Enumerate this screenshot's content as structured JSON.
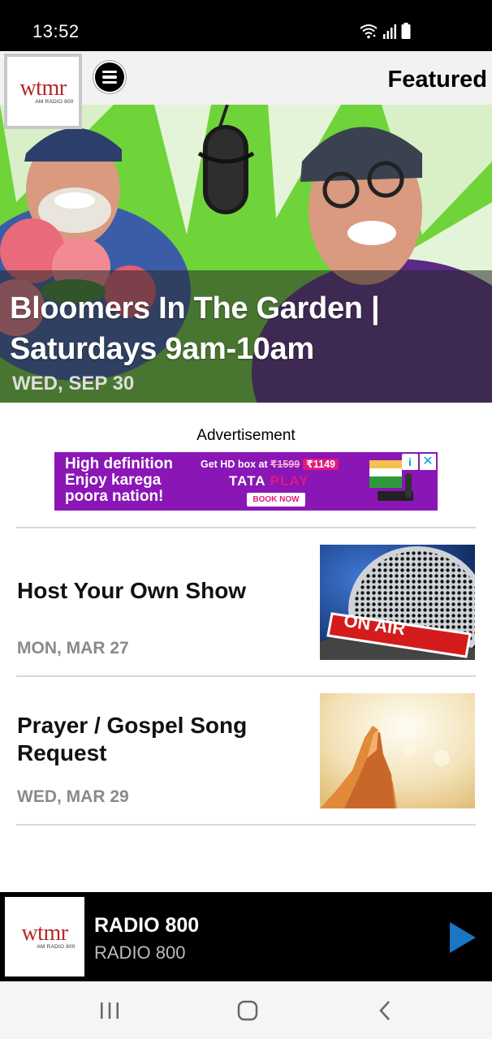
{
  "status_bar": {
    "time": "13:52",
    "icons": [
      "wifi-icon",
      "signal-icon",
      "battery-icon"
    ]
  },
  "header": {
    "logo": {
      "text": "wtmr",
      "subtext": "AM RADIO 800"
    },
    "menu_icon": "hamburger-menu-icon",
    "title": "Featured"
  },
  "hero": {
    "title": "Bloomers In The Garden | Saturdays 9am-10am",
    "date": "WED, SEP 30"
  },
  "ad": {
    "label": "Advertisement",
    "headline": "High definition Enjoy karega poora nation!",
    "line1": "High definition",
    "line2": "Enjoy karega",
    "line3": "poora nation!",
    "offer": "Get HD box at",
    "old_price": "₹1599",
    "new_price": "₹1149",
    "brand_a": "TATA",
    "brand_b": "PLAY",
    "cta": "BOOK NOW",
    "info": "i",
    "close": "✕"
  },
  "articles": [
    {
      "title": "Host Your Own Show",
      "date": "MON, MAR 27",
      "thumb": "on-air-microphone-image",
      "thumb_text": "ON AIR"
    },
    {
      "title": "Prayer / Gospel Song Request",
      "date": "WED, MAR 29",
      "thumb": "praying-hands-image"
    }
  ],
  "player": {
    "logo_text": "wtmr",
    "logo_subtext": "AM RADIO 800",
    "title": "RADIO 800",
    "subtitle": "RADIO 800",
    "play_icon": "play-icon"
  },
  "nav": {
    "recents": "recents-icon",
    "home": "home-icon",
    "back": "back-icon"
  },
  "colors": {
    "brand_red": "#b5252a",
    "play_blue": "#1a75c4",
    "ad_purple": "#8a16b6",
    "ad_pink": "#e2197b",
    "hero_green": "#6fd43a"
  }
}
